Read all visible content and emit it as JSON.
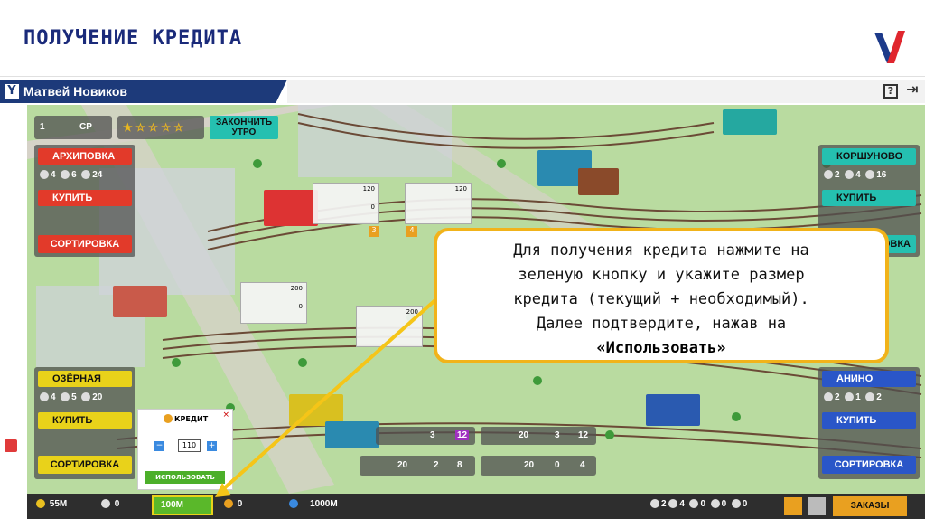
{
  "slide": {
    "title": "ПОЛУЧЕНИЕ КРЕДИТА"
  },
  "app": {
    "user_name": "Матвей Новиков",
    "logo_letter": "Y",
    "help_icon": "question-icon",
    "exit_icon": "exit-icon"
  },
  "game": {
    "day_label": "1",
    "day_name": "СР",
    "finish_button": "ЗАКОНЧИТЬ УТРО",
    "left_stations": [
      {
        "name": "АРХИПОВКА",
        "stats": [
          "4",
          "6",
          "24"
        ],
        "buy": "КУПИТЬ",
        "sort": "СОРТИРОВКА"
      },
      {
        "name": "ОЗЁРНАЯ",
        "stats": [
          "4",
          "5",
          "20"
        ],
        "buy": "КУПИТЬ",
        "sort": "СОРТИРОВКА"
      }
    ],
    "right_stations": [
      {
        "name": "КОРШУНОВО",
        "stats": [
          "2",
          "4",
          "16"
        ],
        "buy": "КУПИТЬ",
        "sort": "РОВКА"
      },
      {
        "name": "АНИНО",
        "stats": [
          "2",
          "1",
          "2"
        ],
        "buy": "КУПИТЬ",
        "sort": "СОРТИРОВКА"
      }
    ],
    "info_values": [
      "120",
      "0",
      "120",
      "200",
      "0",
      "200"
    ],
    "track_numbers": [
      "3",
      "4"
    ],
    "cargo_cards": [
      {
        "a": "3",
        "b": "12"
      },
      {
        "a": "20",
        "b": "3",
        "c": "12"
      },
      {
        "a": "20",
        "b": "2",
        "c": "8"
      },
      {
        "a": "20",
        "b": "0",
        "c": "4"
      }
    ]
  },
  "credit_modal": {
    "title": "КРЕДИТ",
    "close": "×",
    "minus": "−",
    "value": "110",
    "plus": "+",
    "use_button": "ИСПОЛЬЗОВАТЬ"
  },
  "bottom_bar": {
    "money": "55M",
    "stat_a": "0",
    "credit_button": "100M",
    "stat_b": "0",
    "total": "1000M",
    "right_stats": [
      "2",
      "4",
      "0",
      "0",
      "0"
    ],
    "orders_button": "ЗАКАЗЫ"
  },
  "callout": {
    "line1": "Для получения кредита нажмите на",
    "line2": "зеленую кнопку и укажите размер",
    "line3": "кредита (текущий + необходимый).",
    "line4": "Далее подтвердите, нажав на",
    "highlight": "«Использовать»"
  },
  "colors": {
    "title": "#1a2a7a",
    "callout_border": "#f1b31a",
    "red_button": "#e23a2a",
    "yellow_button": "#e9d21a",
    "blue_button": "#2a56c8",
    "green_button": "#4caf2a",
    "arrow": "#f5c518"
  }
}
